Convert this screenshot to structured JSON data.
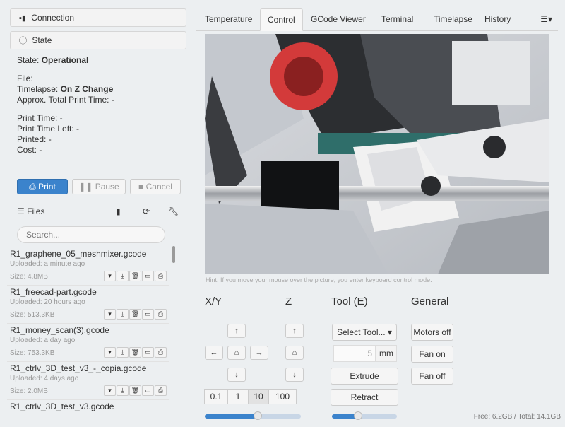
{
  "sidebar": {
    "connection_label": "Connection",
    "state_label": "State",
    "state": {
      "state_prefix": "State:",
      "state_value": "Operational",
      "file_label": "File:",
      "timelapse_prefix": "Timelapse:",
      "timelapse_value": "On Z Change",
      "approx_total": "Approx. Total Print Time: -",
      "print_time": "Print Time: -",
      "print_time_left": "Print Time Left: -",
      "printed": "Printed: -",
      "cost": "Cost: -"
    },
    "buttons": {
      "print": "Print",
      "pause": "Pause",
      "cancel": "Cancel"
    },
    "files_label": "Files",
    "search_placeholder": "Search...",
    "files": [
      {
        "name": "R1_graphene_05_meshmixer.gcode",
        "uploaded": "Uploaded: a minute ago",
        "size": "Size: 4.8MB"
      },
      {
        "name": "R1_freecad-part.gcode",
        "uploaded": "Uploaded: 20 hours ago",
        "size": "Size: 513.3KB"
      },
      {
        "name": "R1_money_scan(3).gcode",
        "uploaded": "Uploaded: a day ago",
        "size": "Size: 753.3KB"
      },
      {
        "name": "R1_ctrlv_3D_test_v3_-_copia.gcode",
        "uploaded": "Uploaded: 4 days ago",
        "size": "Size: 2.0MB"
      },
      {
        "name": "R1_ctrlv_3D_test_v3.gcode",
        "uploaded": "",
        "size": ""
      }
    ],
    "free_space": "Free: 6.2GB / Total: 14.1GB"
  },
  "tabs": [
    "Temperature",
    "Control",
    "GCode Viewer",
    "Terminal",
    "Timelapse",
    "History"
  ],
  "active_tab": "Control",
  "webcam_hint": "Hint: If you move your mouse over the picture, you enter keyboard control mode.",
  "control": {
    "xy_title": "X/Y",
    "z_title": "Z",
    "tool_title": "Tool (E)",
    "general_title": "General",
    "step_sizes": [
      "0.1",
      "1",
      "10",
      "100"
    ],
    "selected_step": "10",
    "tool_select": "Select Tool...",
    "extrude_amount": "5",
    "extrude_unit": "mm",
    "extrude": "Extrude",
    "retract": "Retract",
    "motors_off": "Motors off",
    "fan_on": "Fan on",
    "fan_off": "Fan off",
    "feedrate_level": 0.55,
    "flowrate_level": 0.4
  },
  "colors": {
    "primary": "#3b83cc",
    "background": "#eceff1"
  }
}
